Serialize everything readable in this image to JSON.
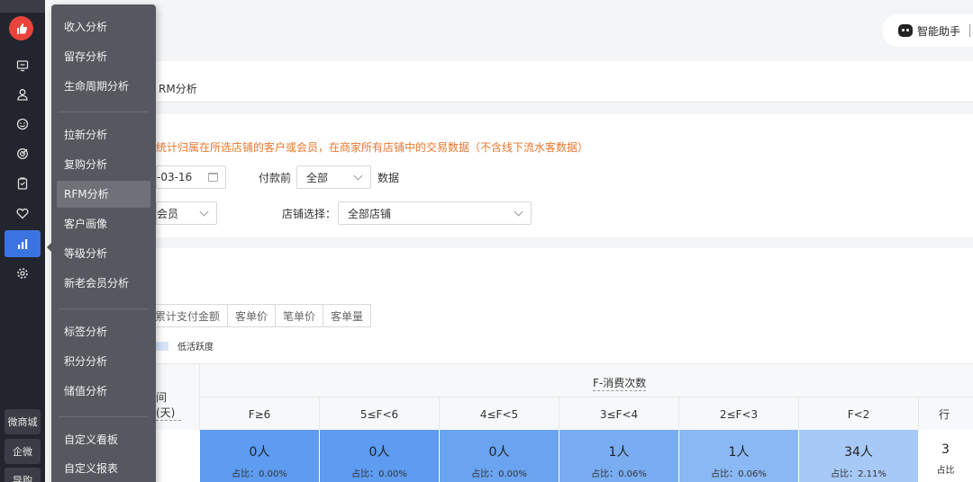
{
  "rail": {
    "icons": [
      "monitor-icon",
      "user-icon",
      "smile-icon",
      "target-icon",
      "clipboard-icon",
      "heart-icon",
      "bar-chart-icon",
      "settings-icon"
    ],
    "bottom": [
      "微商城",
      "企微",
      "导购"
    ]
  },
  "menu": {
    "group1": [
      "收入分析",
      "留存分析",
      "生命周期分析"
    ],
    "group2": [
      "拉新分析",
      "复购分析",
      "RFM分析",
      "客户画像",
      "等级分析",
      "新老会员分析"
    ],
    "group3": [
      "标签分析",
      "积分分析",
      "储值分析"
    ],
    "group4": [
      "自定义看板",
      "自定义报表"
    ],
    "active": "RFM分析"
  },
  "header": {
    "assistant": "智能助手"
  },
  "tab": "RM分析",
  "filter": {
    "notice": "统计归属在所选店铺的客户或会员，在商家所有店铺中的交易数据（不含线下流水客数据）",
    "date_value": "-03-16",
    "pay_label": "付款前",
    "pay_value": "全部",
    "data_label": "数据",
    "member_value": "会员",
    "shop_label": "店铺选择：",
    "shop_value": "全部店铺"
  },
  "metrics": [
    "累计支付金额",
    "客单价",
    "笔单价",
    "客单量"
  ],
  "legend": "低活跃度",
  "table": {
    "row_axis": "间 (天)",
    "col_axis": "F-消费次数",
    "columns": [
      "F≥6",
      "5≤F<6",
      "4≤F<5",
      "3≤F<4",
      "2≤F<3",
      "F<2",
      "行"
    ],
    "cells": [
      {
        "v": "0人",
        "p": "占比：0.00%",
        "color": "#5d9cf0"
      },
      {
        "v": "0人",
        "p": "占比：0.00%",
        "color": "#5d9cf0"
      },
      {
        "v": "0人",
        "p": "占比：0.00%",
        "color": "#6aa4f1"
      },
      {
        "v": "1人",
        "p": "占比：0.06%",
        "color": "#78adf2"
      },
      {
        "v": "1人",
        "p": "占比：0.06%",
        "color": "#8ab8f4"
      },
      {
        "v": "34人",
        "p": "占比：2.11%",
        "color": "#a6c9f6"
      },
      {
        "v": "3",
        "p": "占比",
        "color": "#ffffff"
      }
    ]
  }
}
